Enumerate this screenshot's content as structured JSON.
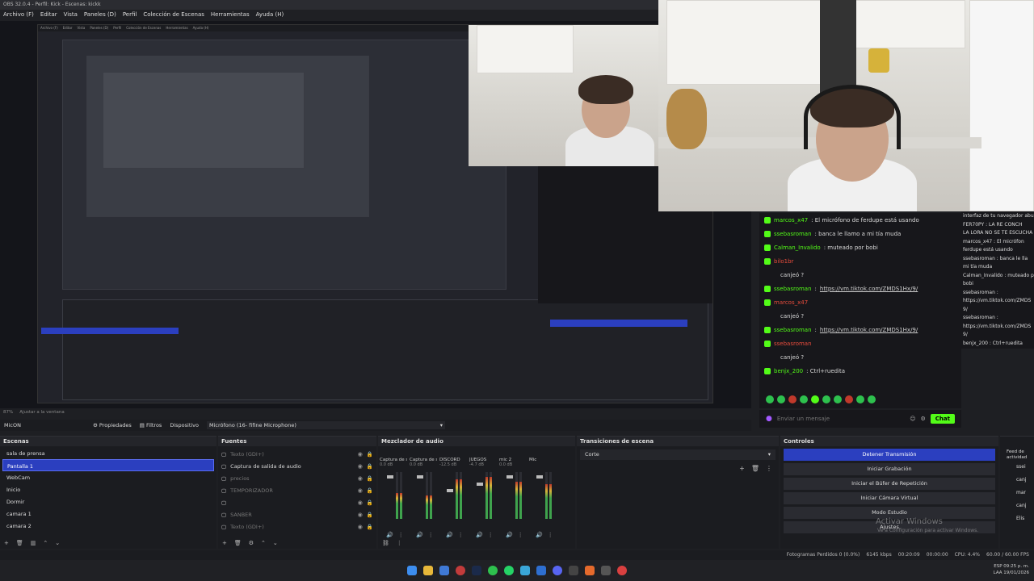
{
  "window": {
    "title": "OBS 32.0.4 - Perfil: Kick - Escenas: kickk"
  },
  "menubar": [
    "Archivo (F)",
    "Editar",
    "Vista",
    "Paneles (D)",
    "Perfil",
    "Colección de Escenas",
    "Herramientas",
    "Ayuda (H)"
  ],
  "nested_preview": {
    "menu": [
      "Archivo (F)",
      "Editar",
      "Vista",
      "Paneles (D)",
      "Perfil",
      "Colección de Escenas",
      "Herramientas",
      "Ayuda (H)"
    ]
  },
  "preview_zoom": "87%",
  "preview_fit": "Ajustar a la ventana",
  "chat": {
    "messages": [
      {
        "user": "marcos_x47",
        "text": ": El micrófono de ferdupe está usando",
        "color": "green"
      },
      {
        "user": "ssebasroman",
        "text": ": banca le llamo a mi tía muda",
        "color": "green"
      },
      {
        "user": "Calman_Invalido",
        "text": ": muteado por bobi",
        "color": "green"
      },
      {
        "user": "bilo1br",
        "text": "",
        "color": "red"
      },
      {
        "user": "",
        "text": "canjeó ?",
        "color": "none"
      },
      {
        "user": "ssebasroman",
        "text": ": ",
        "link": "https://vm.tiktok.com/ZMDS1Hx/9/",
        "color": "green"
      },
      {
        "user": "marcos_x47",
        "text": "",
        "color": "red"
      },
      {
        "user": "",
        "text": "canjeó ?",
        "color": "none"
      },
      {
        "user": "ssebasroman",
        "text": ": ",
        "link": "https://vm.tiktok.com/ZMDS1Hx/9/",
        "color": "green"
      },
      {
        "user": "ssebasroman",
        "text": "",
        "color": "red"
      },
      {
        "user": "",
        "text": "canjeó ?",
        "color": "none"
      },
      {
        "user": "benjx_200",
        "text": ": Ctrl+ruedita",
        "color": "green"
      }
    ],
    "input_placeholder": "Enviar un mensaje",
    "send_label": "Chat"
  },
  "side_chat": [
    "interfaz de tu navegador abu",
    "FER70PY : LA RE CONCH",
    "LA LORA NO SE TE ESCUCHA",
    "marcos_x47 : El micrófon",
    "ferdupe está usando",
    "ssebasroman : banca le lla",
    "mi tía muda",
    "Calman_Invalido : muteado p",
    "bobi",
    "ssebasroman :",
    "https://vm.tiktok.com/ZMDS",
    "9/",
    "ssebasroman :",
    "https://vm.tiktok.com/ZMDS",
    "9/",
    "benjx_200 : Ctrl+ruedita"
  ],
  "source_toolbar": {
    "source_name": "MicON",
    "properties_label": "Propiedades",
    "filters_label": "Filtros",
    "device_label": "Dispositivo",
    "device_value": "Micrófono (16- fifine Microphone)"
  },
  "scenes": {
    "title": "Escenas",
    "items": [
      "sala de prensa",
      "Pantalla 1",
      "WebCam",
      "Inicio",
      "Dormir",
      "camara 1",
      "camara 2"
    ],
    "selected_index": 1
  },
  "sources": {
    "title": "Fuentes",
    "items": [
      {
        "name": "Texto (GDI+)",
        "dim": true
      },
      {
        "name": "Captura de salida de audio",
        "dim": false
      },
      {
        "name": "precios",
        "dim": true
      },
      {
        "name": "TEMPORIZADOR",
        "dim": true
      },
      {
        "name": "",
        "dim": true
      },
      {
        "name": "SANBER",
        "dim": true
      },
      {
        "name": "Texto (GDI+)",
        "dim": true
      }
    ]
  },
  "mixer": {
    "title": "Mezclador de audio",
    "channels": [
      {
        "name": "Captura de salida d",
        "db": "0.0 dB",
        "level": 0.55,
        "fader": 0.9
      },
      {
        "name": "Captura de salida d",
        "db": "0.0 dB",
        "level": 0.5,
        "fader": 0.9
      },
      {
        "name": "DISCORD",
        "db": "-12.5 dB",
        "level": 0.85,
        "fader": 0.6
      },
      {
        "name": "JUEGOS",
        "db": "-4.7 dB",
        "level": 0.9,
        "fader": 0.75
      },
      {
        "name": "mic 2",
        "db": "0.0 dB",
        "level": 0.8,
        "fader": 0.9
      },
      {
        "name": "Mic",
        "db": "",
        "level": 0.75,
        "fader": 0.9
      }
    ]
  },
  "transitions": {
    "title": "Transiciones de escena",
    "current": "Corte"
  },
  "controls": {
    "title": "Controles",
    "buttons": [
      "Detener Transmisión",
      "Iniciar Grabación",
      "Iniciar el Búfer de Repetición",
      "Iniciar Cámara Virtual",
      "Modo Estudio",
      "Ajustes"
    ]
  },
  "activity": {
    "title": "Feed de actividad",
    "items": [
      "ssei",
      "canj",
      "mar",
      "canj",
      "Elis"
    ]
  },
  "watermark": {
    "title": "Activar Windows",
    "subtitle": "Ve a Configuración para activar Windows."
  },
  "status": {
    "dropped": "Fotogramas Perdidos 0 (0.0%)",
    "bitrate": "6145 kbps",
    "live_time": "00:20:09",
    "rec_time": "00:00:00",
    "cpu": "CPU: 4.4%",
    "fps": "60.00 / 60.00 FPS"
  },
  "tray": {
    "lang": "ESP",
    "region": "LAA",
    "time": "09:25 p. m.",
    "date": "19/01/2026"
  }
}
